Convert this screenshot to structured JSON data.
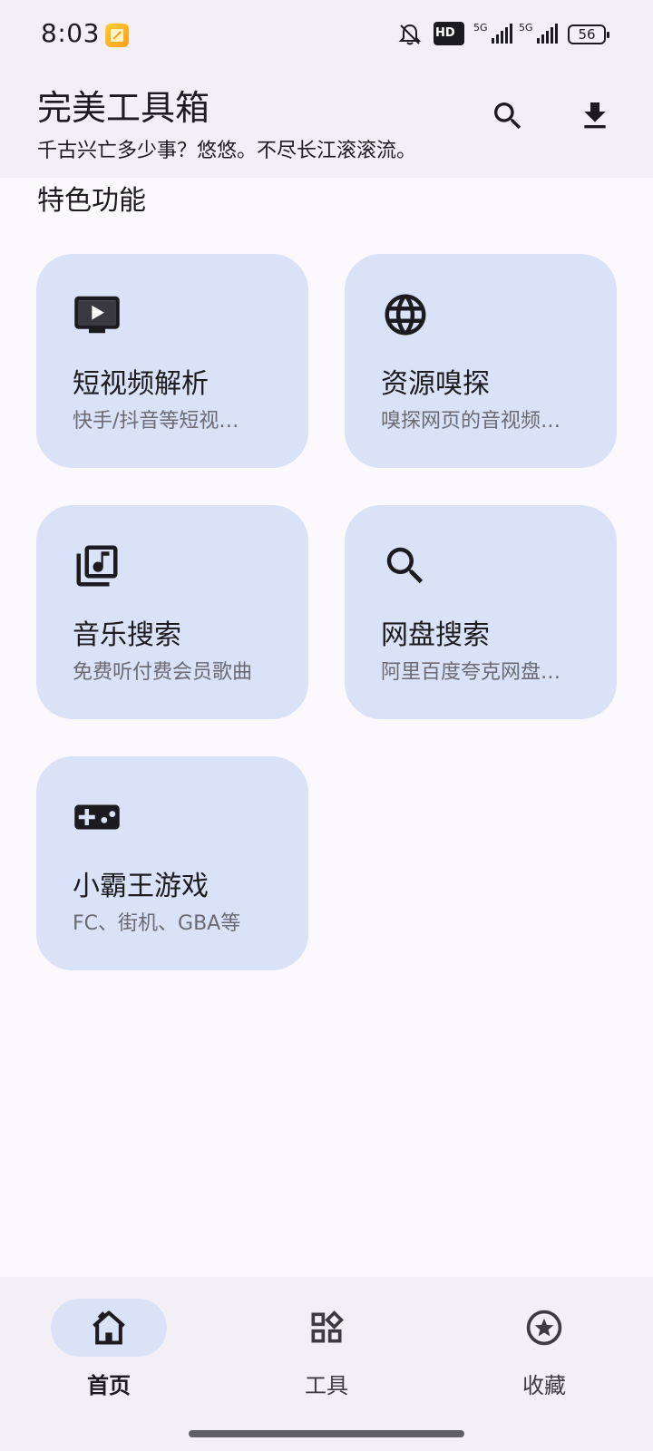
{
  "status_bar": {
    "time": "8:03",
    "hd_label": "HD",
    "network_1": "5G",
    "network_2": "5G",
    "battery": "56"
  },
  "app_bar": {
    "title": "完美工具箱",
    "subtitle": "千古兴亡多少事？悠悠。不尽长江滚滚流。",
    "actions": [
      "search-icon",
      "download-icon"
    ]
  },
  "section": {
    "title": "特色功能"
  },
  "cards": [
    {
      "icon": "tv-play-icon",
      "title": "短视频解析",
      "desc": "快手/抖音等短视…"
    },
    {
      "icon": "globe-icon",
      "title": "资源嗅探",
      "desc": "嗅探网页的音视频…"
    },
    {
      "icon": "music-library-icon",
      "title": "音乐搜索",
      "desc": "免费听付费会员歌曲"
    },
    {
      "icon": "search-icon",
      "title": "网盘搜索",
      "desc": "阿里百度夸克网盘…"
    },
    {
      "icon": "gamepad-icon",
      "title": "小霸王游戏",
      "desc": "FC、街机、GBA等"
    }
  ],
  "bottom_nav": {
    "items": [
      {
        "icon": "home-icon",
        "label": "首页",
        "active": true
      },
      {
        "icon": "widgets-icon",
        "label": "工具",
        "active": false
      },
      {
        "icon": "star-circle-icon",
        "label": "收藏",
        "active": false
      }
    ]
  },
  "colors": {
    "background": "#fbf8fe",
    "bar_surface": "#f2eff5",
    "card_surface": "#d9e2f7",
    "text_primary": "#1c1b1f",
    "text_secondary": "#6b6a72"
  }
}
